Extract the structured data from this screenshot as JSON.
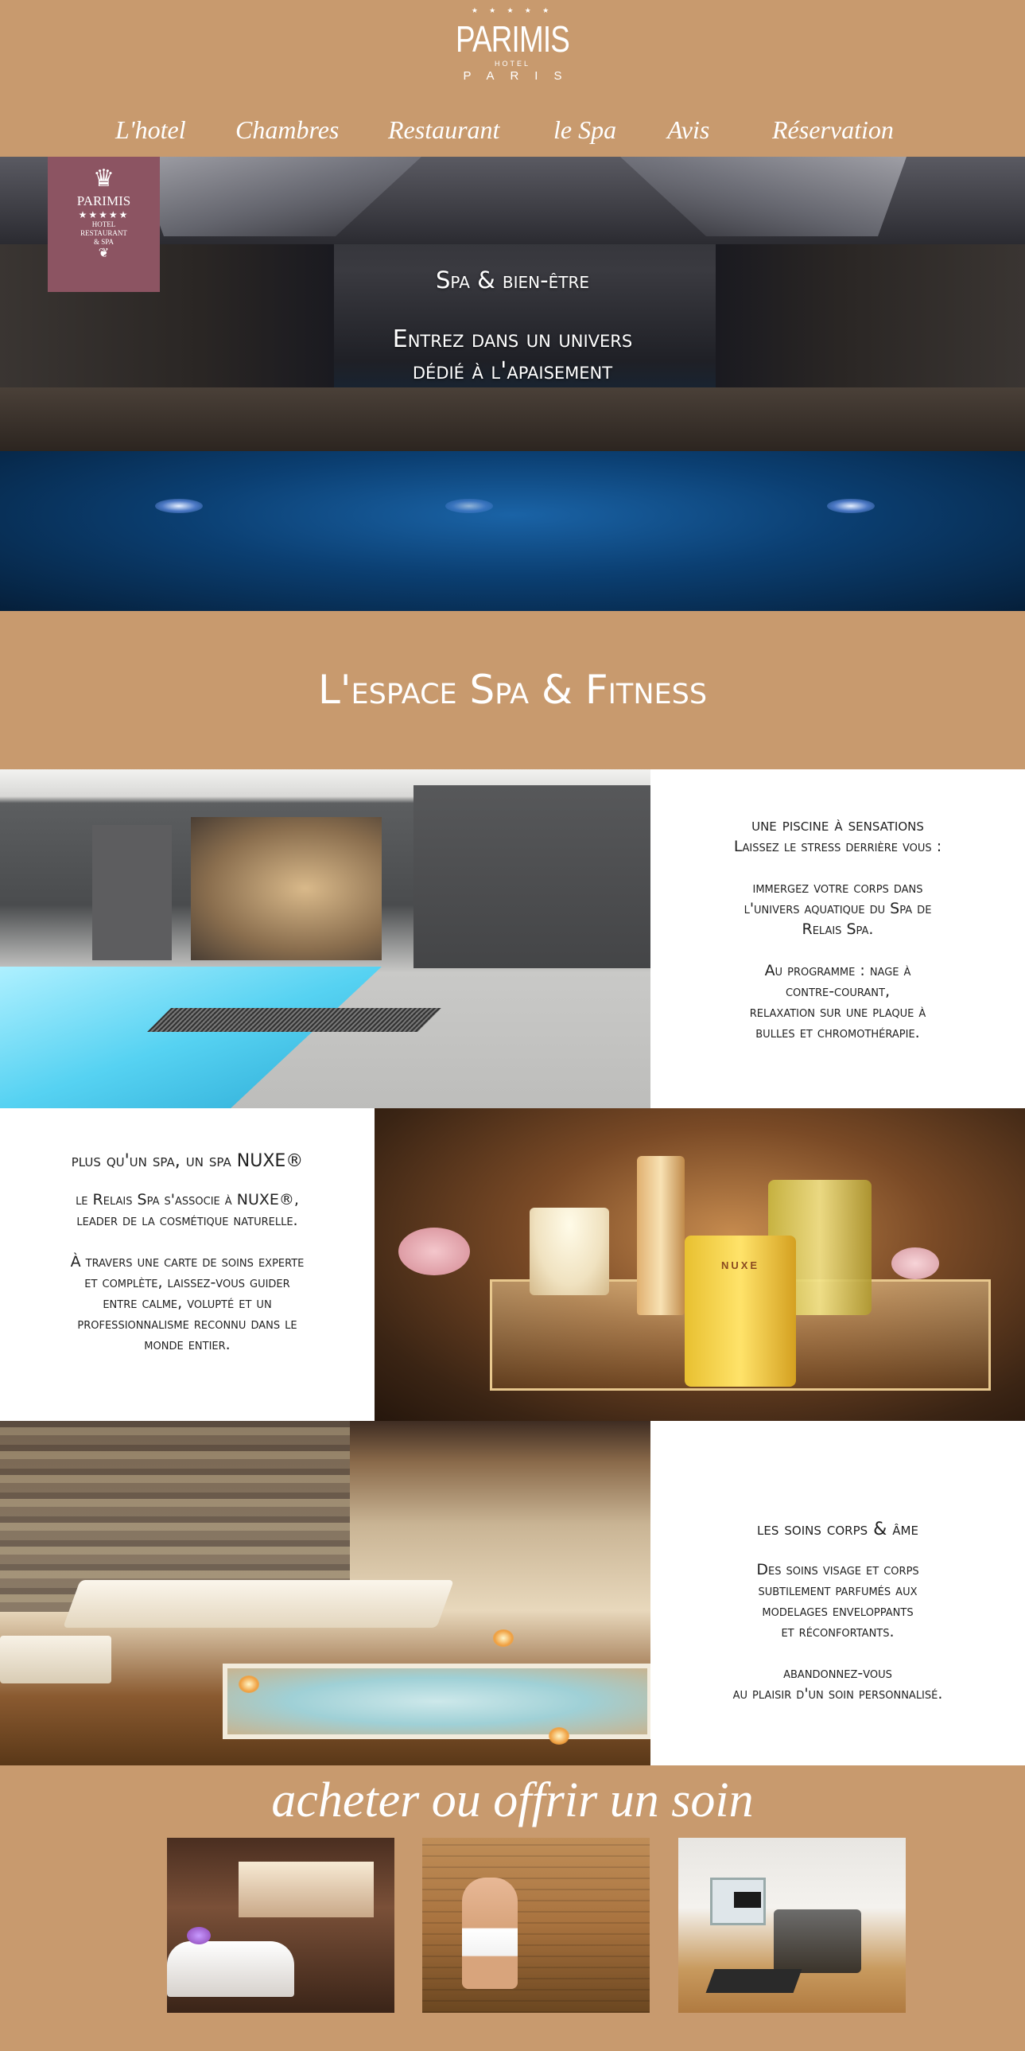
{
  "header": {
    "logo": {
      "stars": "★ ★ ★ ★ ★",
      "name": "PARIMIS",
      "hotel": "HOTEL",
      "city": "PARIS"
    },
    "nav": [
      {
        "label": "L'hotel"
      },
      {
        "label": "Chambres"
      },
      {
        "label": "Restaurant"
      },
      {
        "label": "le Spa"
      },
      {
        "label": "Avis"
      },
      {
        "label": "Réservation"
      }
    ]
  },
  "hero": {
    "badge": {
      "crown": "♛",
      "name": "PARIMIS",
      "stars": "★★★★★",
      "line1": "HOTEL",
      "line2": "RESTAURANT",
      "line3": "& SPA",
      "ornament": "❦"
    },
    "subtitle": "Spa & bien-être",
    "headline_1": "Entrez dans un univers",
    "headline_2": "dédié à l'apaisement"
  },
  "section": {
    "title": "L'espace Spa & Fitness"
  },
  "blocks": [
    {
      "title_1": "une piscine à sensations",
      "title_2": "Laissez le stress derrière vous :",
      "p1_1": "immergez votre corps dans",
      "p1_2": "l'univers aquatique du Spa de",
      "p1_3": "Relais Spa.",
      "p2_1": "Au programme : nage à",
      "p2_2": "contre-courant,",
      "p2_3": "relaxation sur une plaque à",
      "p2_4": "bulles et chromothérapie."
    },
    {
      "title_1": "plus qu'un spa, un spa NUXE®",
      "p1_1": "le Relais Spa s'associe à NUXE®,",
      "p1_2": "leader de la cosmétique naturelle.",
      "p2_1": "À travers une carte de soins experte",
      "p2_2": "et complète, laissez-vous guider",
      "p2_3": "entre calme, volupté et un",
      "p2_4": "professionnalisme reconnu dans le",
      "p2_5": "monde entier.",
      "product_label": "NUXE"
    },
    {
      "title_1": "les soins corps & âme",
      "p1_1": "Des soins visage et corps",
      "p1_2": "subtilement parfumés aux",
      "p1_3": "modelages enveloppants",
      "p1_4": "et réconfortants.",
      "p2_1": "abandonnez-vous",
      "p2_2": "au plaisir d'un soin personnalisé."
    }
  ],
  "shop": {
    "title": "acheter ou offrir un soin"
  },
  "colors": {
    "background": "#c89a6e",
    "badge": "#8c5462",
    "text": "#222222"
  }
}
